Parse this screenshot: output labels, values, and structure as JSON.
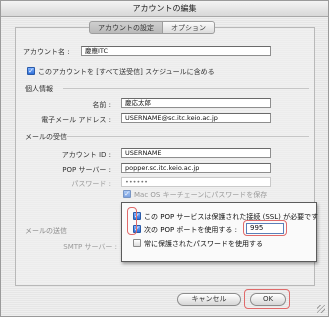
{
  "window": {
    "title": "アカウントの編集"
  },
  "tabs": [
    {
      "label": "アカウントの設定"
    },
    {
      "label": "オプション"
    }
  ],
  "account": {
    "name_label": "アカウント名 :",
    "name_value": "慶應ITC",
    "include_label": "このアカウントを [すべて送受信] スケジュールに含める"
  },
  "personal": {
    "section_label": "個人情報",
    "name_label": "名前 :",
    "name_value": "慶応太郎",
    "email_label": "電子メール アドレス :",
    "email_value": "USERNAME@sc.itc.keio.ac.jp"
  },
  "incoming": {
    "section_label": "メールの受信",
    "account_id_label": "アカウント ID :",
    "account_id_value": "USERNAME",
    "pop_server_label": "POP サーバー :",
    "pop_server_value": "popper.sc.itc.keio.ac.jp",
    "password_label": "パスワード :",
    "password_value": "••••••",
    "keychain_label": "Mac OS キーチェーンにパスワードを保存"
  },
  "outgoing": {
    "section_label": "メールの送信",
    "smtp_label": "SMTP サーバー :"
  },
  "popup": {
    "ssl_label": "この POP サービスは保護された接続 (SSL) が必要です",
    "port_label": "次の POP ポートを使用する :",
    "port_value": "995",
    "secure_pw_label": "常に保護されたパスワードを使用する"
  },
  "buttons": {
    "cancel": "キャンセル",
    "ok": "OK"
  },
  "colors": {
    "highlight": "#e06a6a",
    "checkbox_checked": "#2f6fd8"
  }
}
